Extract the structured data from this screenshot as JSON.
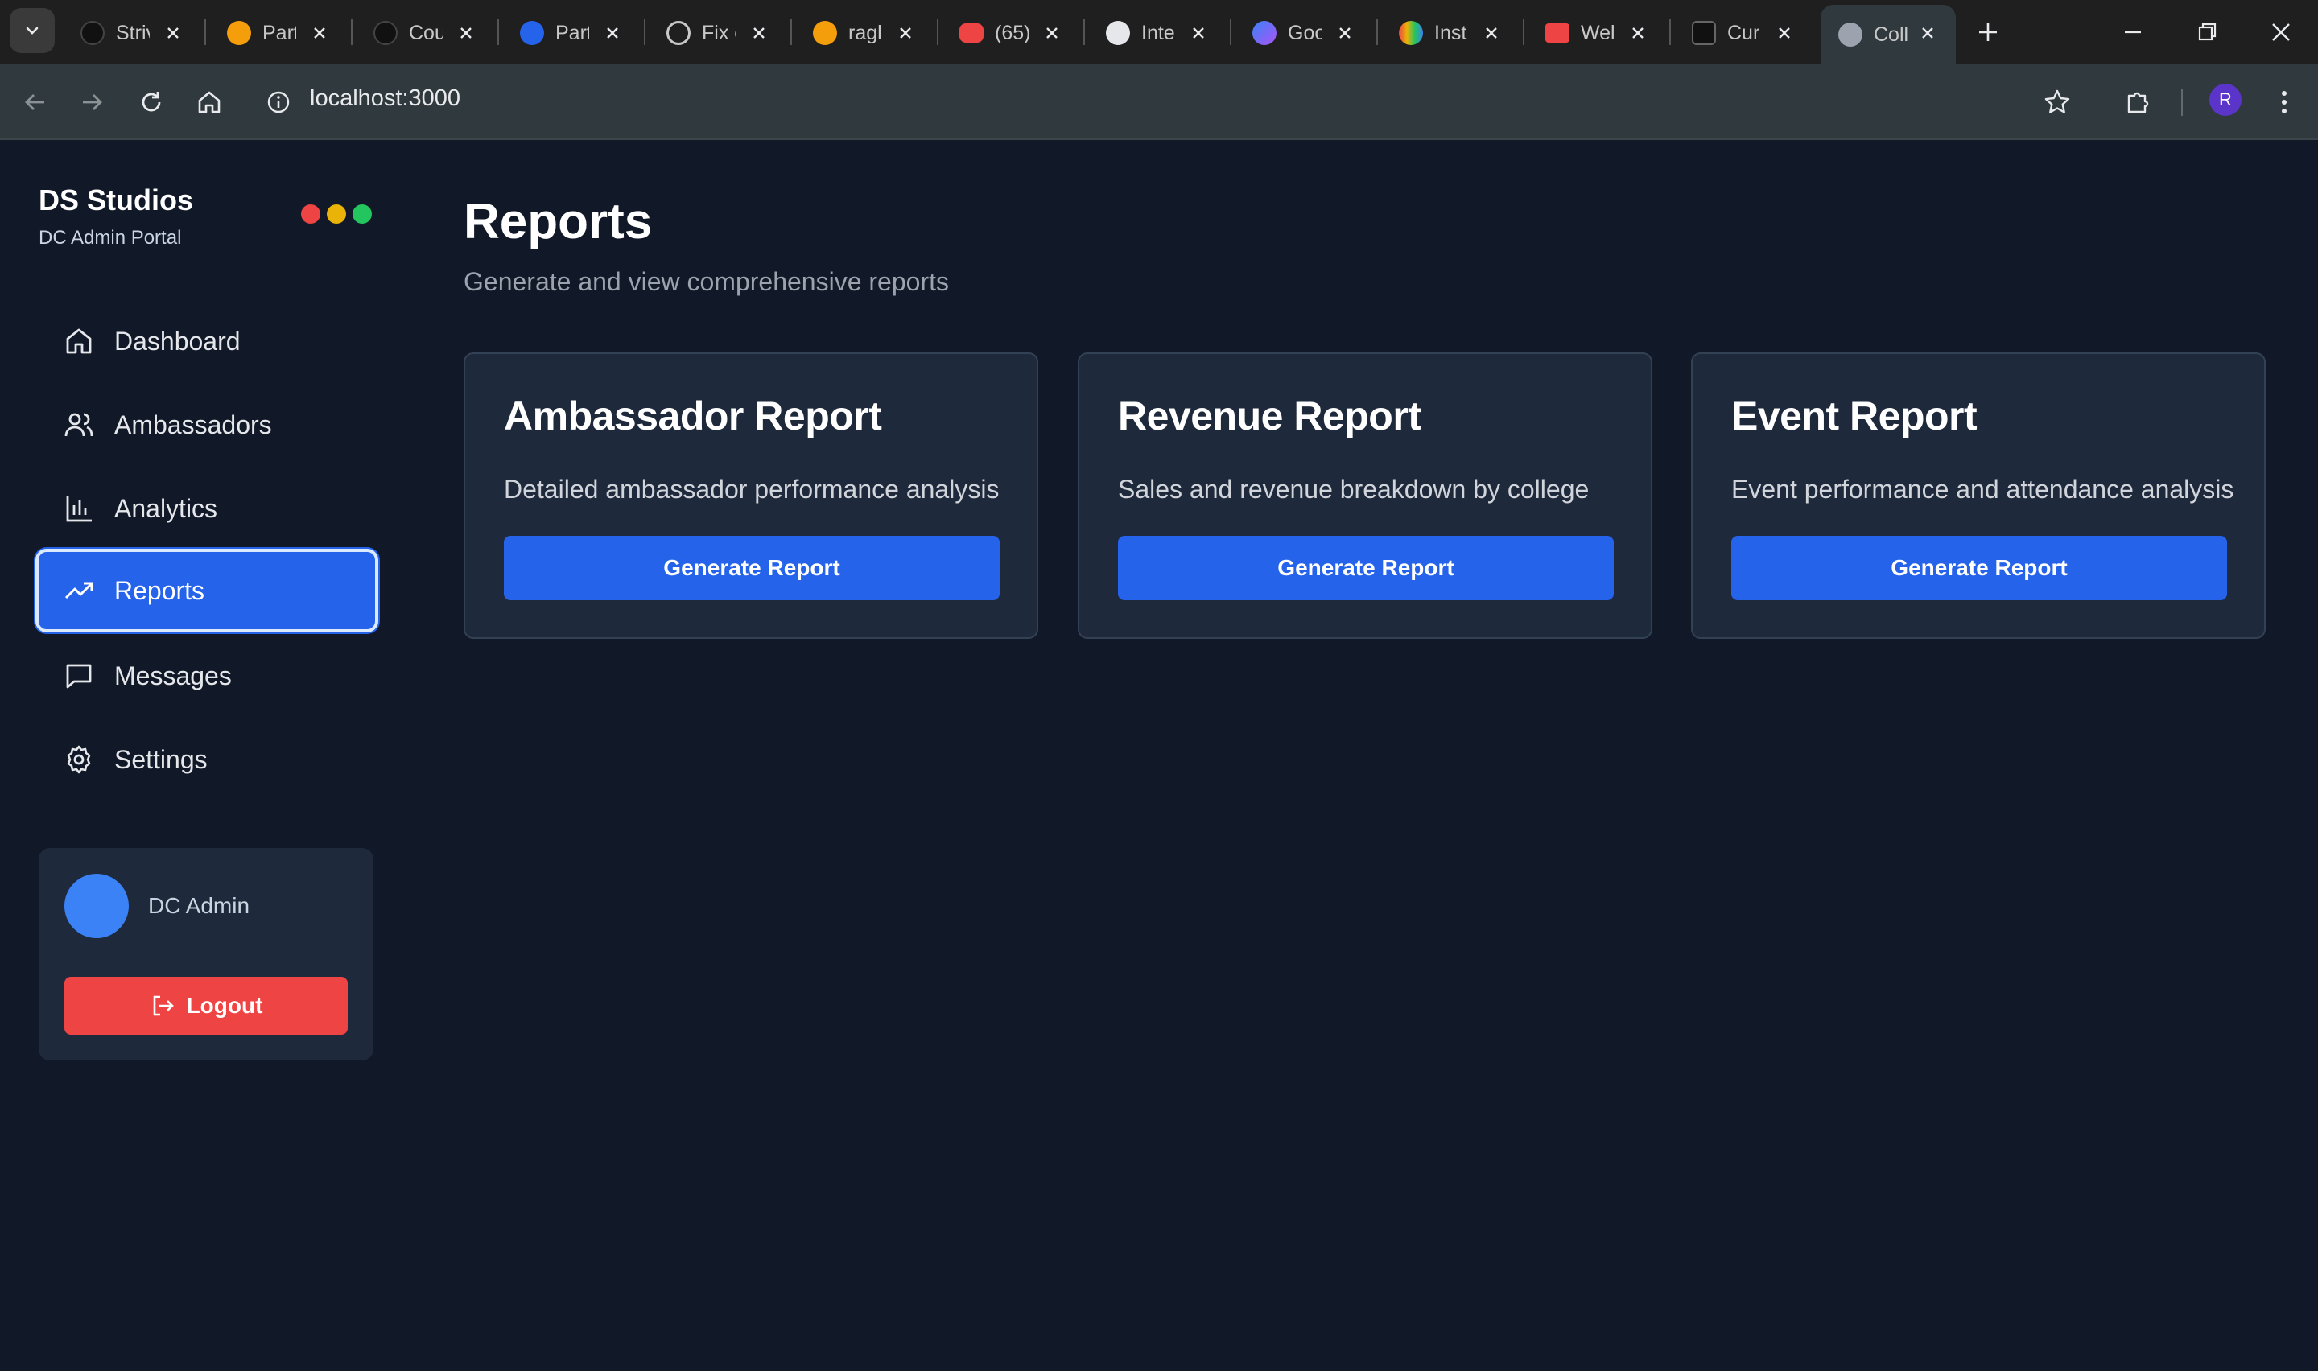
{
  "browser": {
    "tabs": [
      {
        "title": "Striv",
        "favicon_color": "#111111"
      },
      {
        "title": "Part",
        "favicon_color": "#f59e0b"
      },
      {
        "title": "Cou",
        "favicon_color": "#111111"
      },
      {
        "title": "Part",
        "favicon_color": "#2563eb"
      },
      {
        "title": "Fix c",
        "favicon_color": "#9ca3af"
      },
      {
        "title": "ragl",
        "favicon_color": "#f59e0b"
      },
      {
        "title": "(65)",
        "favicon_color": "#ef4444"
      },
      {
        "title": "Inte",
        "favicon_color": "#e5e7eb"
      },
      {
        "title": "Goo",
        "favicon_color": "#3b82f6"
      },
      {
        "title": "Inst",
        "favicon_color": "#22c55e"
      },
      {
        "title": "Wel",
        "favicon_color": "#ef4444"
      },
      {
        "title": "Cur",
        "favicon_color": "#111111"
      },
      {
        "title": "Coll",
        "favicon_color": "#9ca3af"
      }
    ],
    "url": "localhost:3000",
    "profile_initial": "R"
  },
  "sidebar": {
    "brand": "DS Studios",
    "subtitle": "DC Admin Portal",
    "window_dots": [
      "#ef4444",
      "#eab308",
      "#22c55e"
    ],
    "items": [
      {
        "label": "Dashboard",
        "icon": "home-icon"
      },
      {
        "label": "Ambassadors",
        "icon": "users-icon"
      },
      {
        "label": "Analytics",
        "icon": "bar-chart-icon"
      },
      {
        "label": "Reports",
        "icon": "trending-up-icon",
        "active": true
      },
      {
        "label": "Messages",
        "icon": "message-square-icon"
      },
      {
        "label": "Settings",
        "icon": "gear-icon"
      }
    ],
    "user": {
      "name": "DC Admin",
      "logout_label": "Logout"
    }
  },
  "main": {
    "title": "Reports",
    "subtitle": "Generate and view comprehensive reports",
    "cards": [
      {
        "title": "Ambassador Report",
        "description": "Detailed ambassador performance analysis",
        "button": "Generate Report"
      },
      {
        "title": "Revenue Report",
        "description": "Sales and revenue breakdown by college",
        "button": "Generate Report"
      },
      {
        "title": "Event Report",
        "description": "Event performance and attendance analysis",
        "button": "Generate Report"
      }
    ]
  },
  "colors": {
    "background": "#111827",
    "card": "#1e293b",
    "accent": "#2563eb",
    "danger": "#ef4444"
  }
}
